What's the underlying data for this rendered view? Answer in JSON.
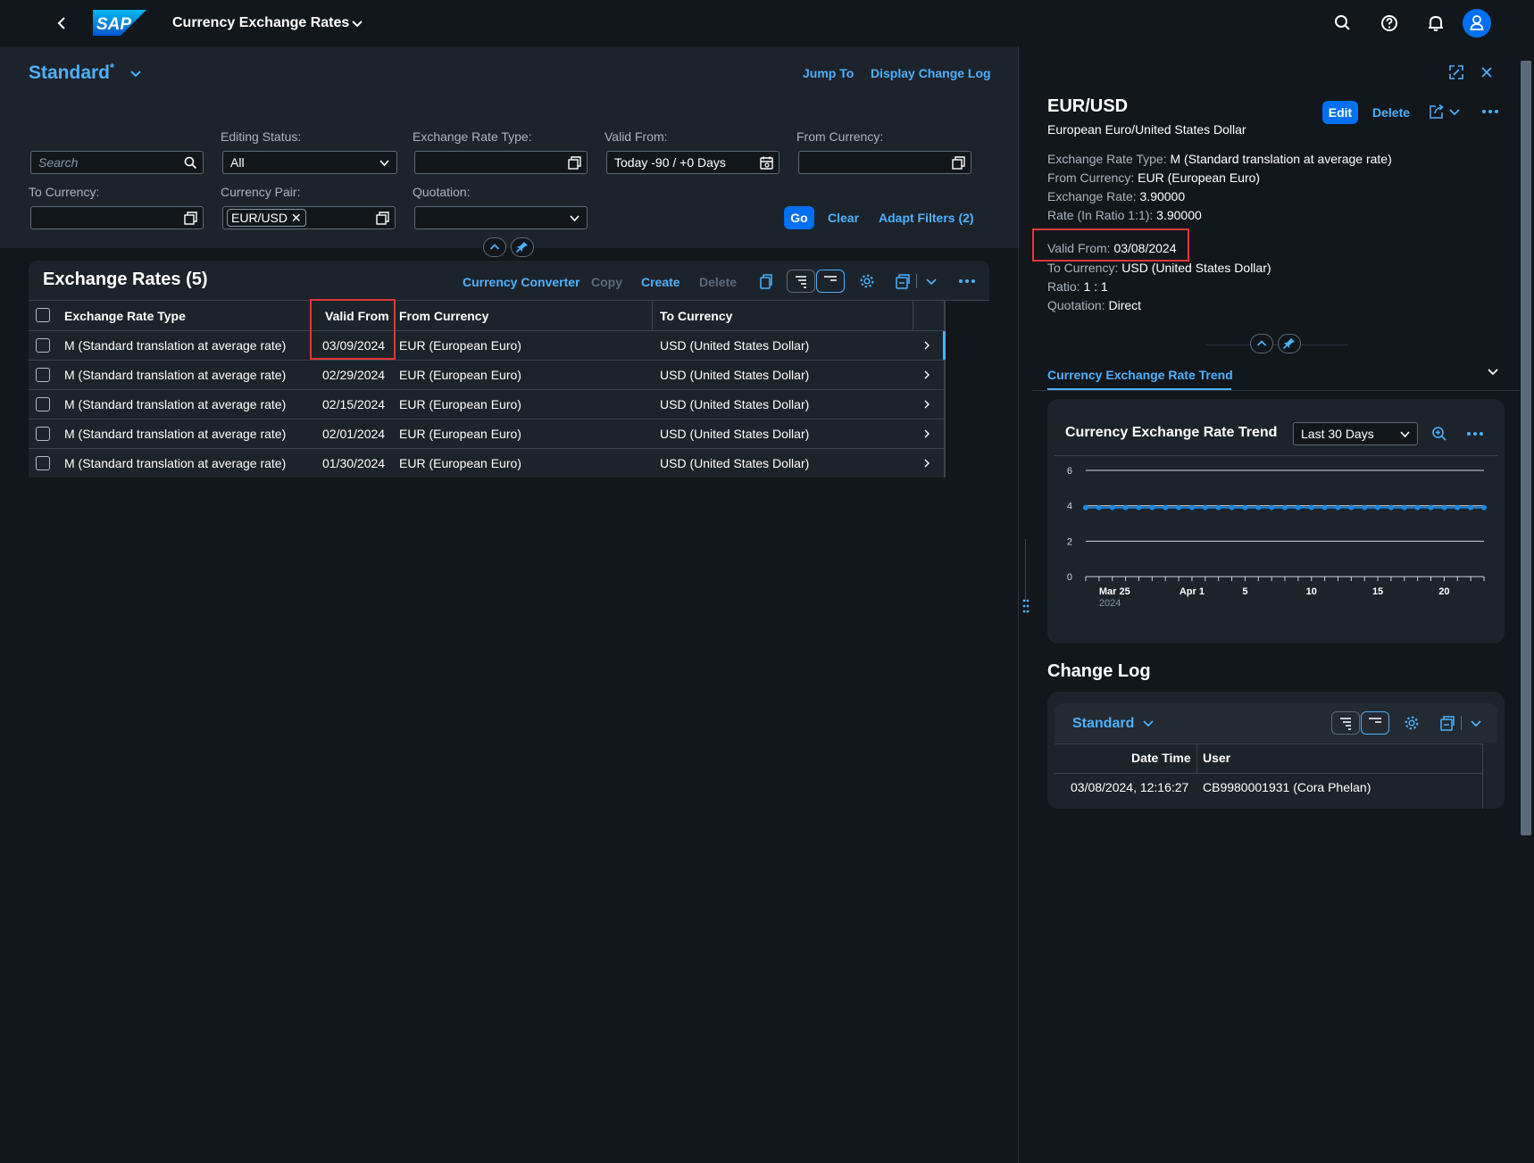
{
  "shell": {
    "title": "Currency Exchange Rates",
    "logo_text": "SAP"
  },
  "filter": {
    "variant": "Standard",
    "variant_mark": "*",
    "jump_to": "Jump To",
    "change_log": "Display Change Log",
    "search_placeholder": "Search",
    "editing_status_label": "Editing Status:",
    "editing_status_value": "All",
    "rate_type_label": "Exchange Rate Type:",
    "valid_from_label": "Valid From:",
    "valid_from_value": "Today -90 / +0 Days",
    "from_currency_label": "From Currency:",
    "to_currency_label": "To Currency:",
    "currency_pair_label": "Currency Pair:",
    "currency_pair_token": "EUR/USD",
    "quotation_label": "Quotation:",
    "go": "Go",
    "clear": "Clear",
    "adapt": "Adapt Filters (2)"
  },
  "table": {
    "title": "Exchange Rates (5)",
    "actions": {
      "converter": "Currency Converter",
      "copy": "Copy",
      "create": "Create",
      "delete": "Delete"
    },
    "columns": [
      "Exchange Rate Type",
      "Valid From",
      "From Currency",
      "To Currency"
    ],
    "rows": [
      [
        "M (Standard translation at average rate)",
        "03/09/2024",
        "EUR (European Euro)",
        "USD (United States Dollar)"
      ],
      [
        "M (Standard translation at average rate)",
        "02/29/2024",
        "EUR (European Euro)",
        "USD (United States Dollar)"
      ],
      [
        "M (Standard translation at average rate)",
        "02/15/2024",
        "EUR (European Euro)",
        "USD (United States Dollar)"
      ],
      [
        "M (Standard translation at average rate)",
        "02/01/2024",
        "EUR (European Euro)",
        "USD (United States Dollar)"
      ],
      [
        "M (Standard translation at average rate)",
        "01/30/2024",
        "EUR (European Euro)",
        "USD (United States Dollar)"
      ]
    ]
  },
  "detail": {
    "title": "EUR/USD",
    "subtitle": "European Euro/United States Dollar",
    "edit": "Edit",
    "delete": "Delete",
    "fields": [
      {
        "label": "Exchange Rate Type:",
        "value": "M (Standard translation at average rate)"
      },
      {
        "label": "From Currency:",
        "value": "EUR (European Euro)"
      },
      {
        "label": "Exchange Rate:",
        "value": "3.90000"
      },
      {
        "label": "Rate (In Ratio 1:1):",
        "value": "3.90000"
      },
      {
        "label": "Valid From:",
        "value": "03/08/2024"
      },
      {
        "label": "To Currency:",
        "value": "USD (United States Dollar)"
      },
      {
        "label": "Ratio:",
        "value": "1 : 1"
      },
      {
        "label": "Quotation:",
        "value": "Direct"
      }
    ],
    "tab": "Currency Exchange Rate Trend",
    "chart_card_title": "Currency Exchange Rate Trend",
    "chart_range": "Last 30 Days",
    "change_log_title": "Change Log",
    "change_log_variant": "Standard",
    "log_columns": [
      "Date Time",
      "User"
    ],
    "log_rows": [
      [
        "03/08/2024, 12:16:27",
        "CB9980001931 (Cora Phelan)"
      ]
    ]
  },
  "chart_data": {
    "type": "line",
    "title": "Currency Exchange Rate Trend",
    "x_tick_labels": [
      "Mar 25",
      "Apr 1",
      "5",
      "10",
      "15",
      "20"
    ],
    "x_year_label": "2024",
    "y_ticks": [
      0,
      2,
      4,
      6
    ],
    "ylim": [
      0,
      6
    ],
    "x_start": "2024-03-24",
    "x_end": "2024-04-23",
    "series": [
      {
        "color": "#1e88e5",
        "x": [
          "2024-03-24",
          "2024-03-25",
          "2024-03-26",
          "2024-03-27",
          "2024-03-28",
          "2024-03-29",
          "2024-03-30",
          "2024-03-31",
          "2024-04-01",
          "2024-04-02",
          "2024-04-03",
          "2024-04-04",
          "2024-04-05",
          "2024-04-06",
          "2024-04-07",
          "2024-04-08",
          "2024-04-09",
          "2024-04-10",
          "2024-04-11",
          "2024-04-12",
          "2024-04-13",
          "2024-04-14",
          "2024-04-15",
          "2024-04-16",
          "2024-04-17",
          "2024-04-18",
          "2024-04-19",
          "2024-04-20",
          "2024-04-21",
          "2024-04-22",
          "2024-04-23"
        ],
        "values": [
          3.9,
          3.9,
          3.9,
          3.9,
          3.9,
          3.9,
          3.9,
          3.9,
          3.9,
          3.9,
          3.9,
          3.9,
          3.9,
          3.9,
          3.9,
          3.9,
          3.9,
          3.9,
          3.9,
          3.9,
          3.9,
          3.9,
          3.9,
          3.9,
          3.9,
          3.9,
          3.9,
          3.9,
          3.9,
          3.9,
          3.9
        ]
      }
    ],
    "grid": true
  },
  "colors": {
    "accent": "#4db1ff",
    "emphasized": "#0070f2",
    "highlight_box": "#e03838"
  }
}
